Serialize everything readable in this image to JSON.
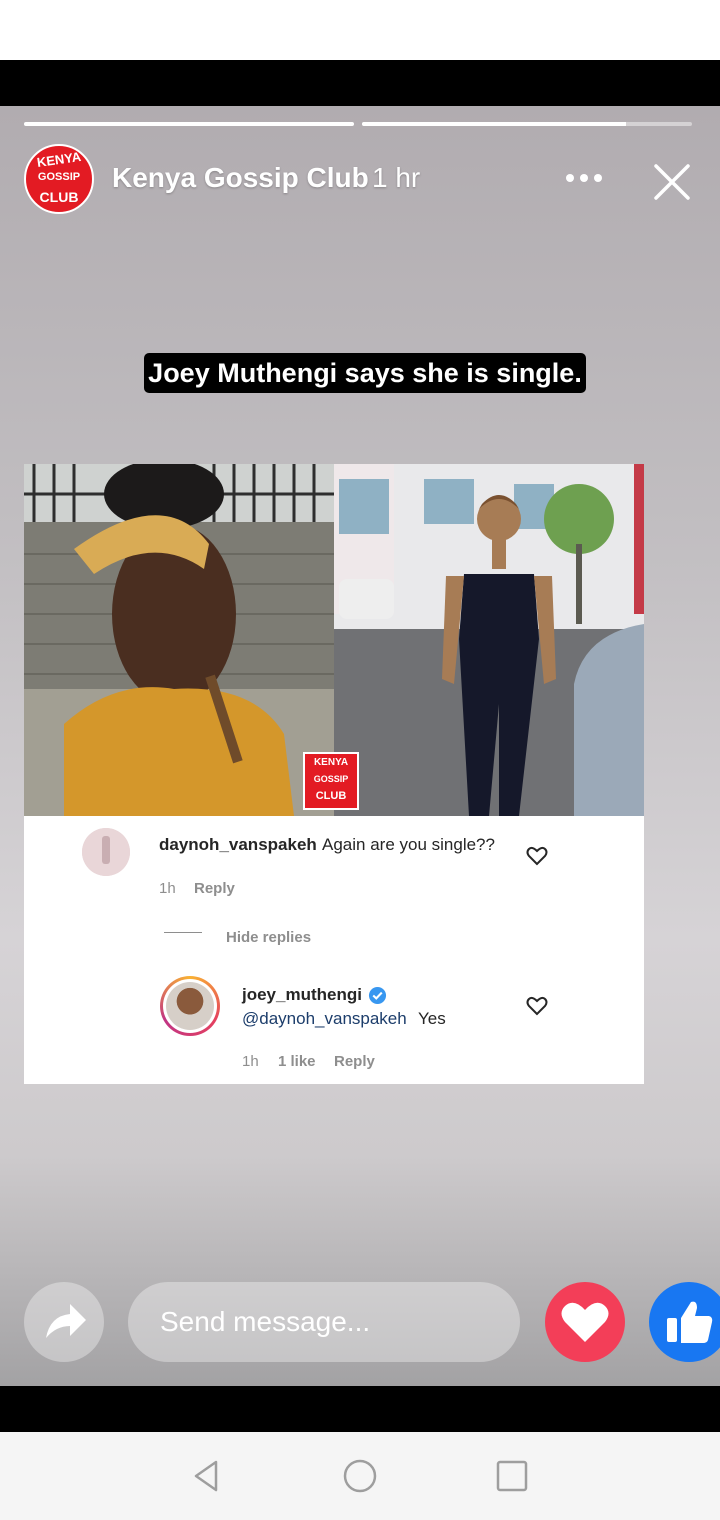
{
  "story": {
    "progress": [
      1.0,
      0.8
    ],
    "page_name": "Kenya Gossip Club",
    "time": "1 hr",
    "logo_lines": [
      "KENYA",
      "GOSSIP",
      "CLUB"
    ],
    "caption": "Joey Muthengi says she is single."
  },
  "post": {
    "comment": {
      "username": "daynoh_vanspakeh",
      "text": "Again are you single??",
      "time": "1h",
      "reply": "Reply"
    },
    "hide_replies": "Hide replies",
    "reply": {
      "username": "joey_muthengi",
      "mention": "@daynoh_vanspakeh",
      "text": "Yes",
      "time": "1h",
      "likes": "1 like",
      "reply": "Reply"
    }
  },
  "footer": {
    "message_placeholder": "Send message..."
  },
  "colors": {
    "brand_red": "#e31b23",
    "love": "#f33e58",
    "like": "#1877f2",
    "verified": "#3897f0"
  }
}
